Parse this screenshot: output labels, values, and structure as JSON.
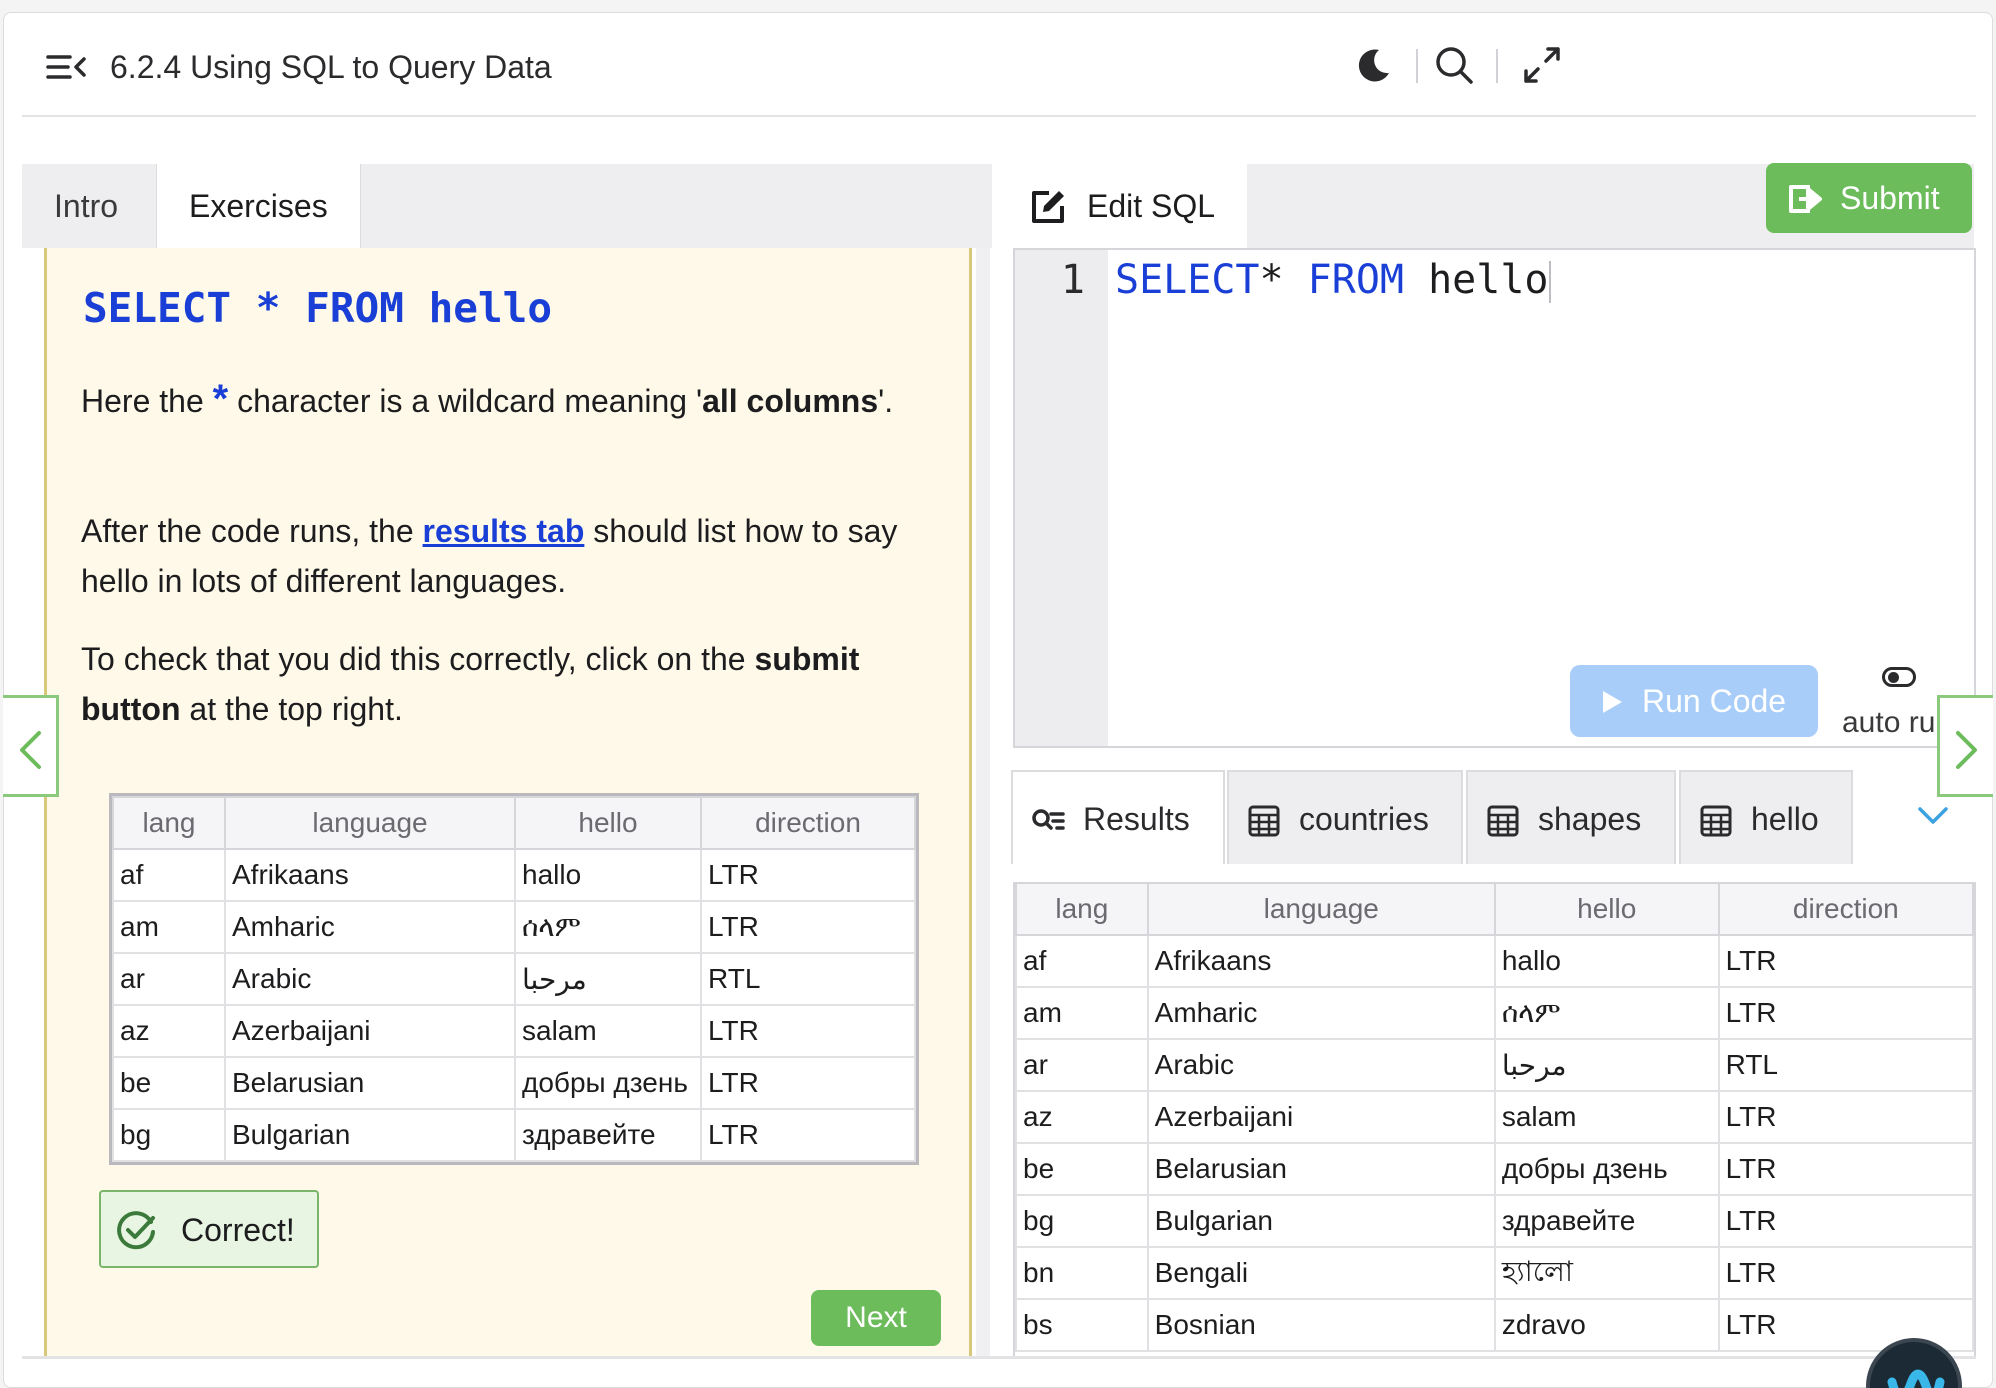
{
  "header": {
    "title": "6.2.4 Using SQL to Query Data"
  },
  "left_tabs": [
    "Intro",
    "Exercises"
  ],
  "exercise": {
    "heading": "SELECT * FROM hello",
    "para1_a": "Here the ",
    "para1_star": "*",
    "para1_b": " character is a wildcard meaning '",
    "para1_bold": "all columns",
    "para1_c": "'.",
    "para2_a": "After the code runs, the ",
    "para2_link": "results tab",
    "para2_b": " should list how to say hello in lots of different languages.",
    "para3_a": "To check that you did this correctly, click on the ",
    "para3_bold": "submit button",
    "para3_b": " at the top right.",
    "correct_label": "Correct!",
    "next_label": "Next"
  },
  "left_table": {
    "headers": [
      "lang",
      "language",
      "hello",
      "direction"
    ],
    "rows": [
      [
        "af",
        "Afrikaans",
        "hallo",
        "LTR"
      ],
      [
        "am",
        "Amharic",
        "ሰላም",
        "LTR"
      ],
      [
        "ar",
        "Arabic",
        "مرحبا",
        "RTL"
      ],
      [
        "az",
        "Azerbaijani",
        "salam",
        "LTR"
      ],
      [
        "be",
        "Belarusian",
        "добры дзень",
        "LTR"
      ],
      [
        "bg",
        "Bulgarian",
        "здравейте",
        "LTR"
      ]
    ]
  },
  "editor": {
    "tab_label": "Edit SQL",
    "submit_label": "Submit",
    "line_number": "1",
    "code_kw1": "SELECT",
    "code_star": "* ",
    "code_kw2": "FROM",
    "code_rest": " hello",
    "run_label": "Run Code",
    "auto_run_label": "auto run"
  },
  "result_tabs": [
    "Results",
    "countries",
    "shapes",
    "hello"
  ],
  "result_table": {
    "headers": [
      "lang",
      "language",
      "hello",
      "direction"
    ],
    "rows": [
      [
        "af",
        "Afrikaans",
        "hallo",
        "LTR"
      ],
      [
        "am",
        "Amharic",
        "ሰላም",
        "LTR"
      ],
      [
        "ar",
        "Arabic",
        "مرحبا",
        "RTL"
      ],
      [
        "az",
        "Azerbaijani",
        "salam",
        "LTR"
      ],
      [
        "be",
        "Belarusian",
        "добры дзень",
        "LTR"
      ],
      [
        "bg",
        "Bulgarian",
        "здравейте",
        "LTR"
      ],
      [
        "bn",
        "Bengali",
        "হ্যালো",
        "LTR"
      ],
      [
        "bs",
        "Bosnian",
        "zdravo",
        "LTR"
      ]
    ]
  },
  "icons": {
    "menu": "menu-collapse-icon",
    "theme": "moon-icon",
    "search": "search-icon",
    "fullscreen": "expand-icon",
    "edit": "edit-icon",
    "submit": "submit-arrow-icon",
    "run": "play-icon",
    "results": "results-icon",
    "table": "table-icon",
    "correct": "check-circle-icon"
  },
  "colors": {
    "accent_blue": "#1a3fd6",
    "green": "#6cbc5c",
    "note_bg": "#fef9e8"
  }
}
